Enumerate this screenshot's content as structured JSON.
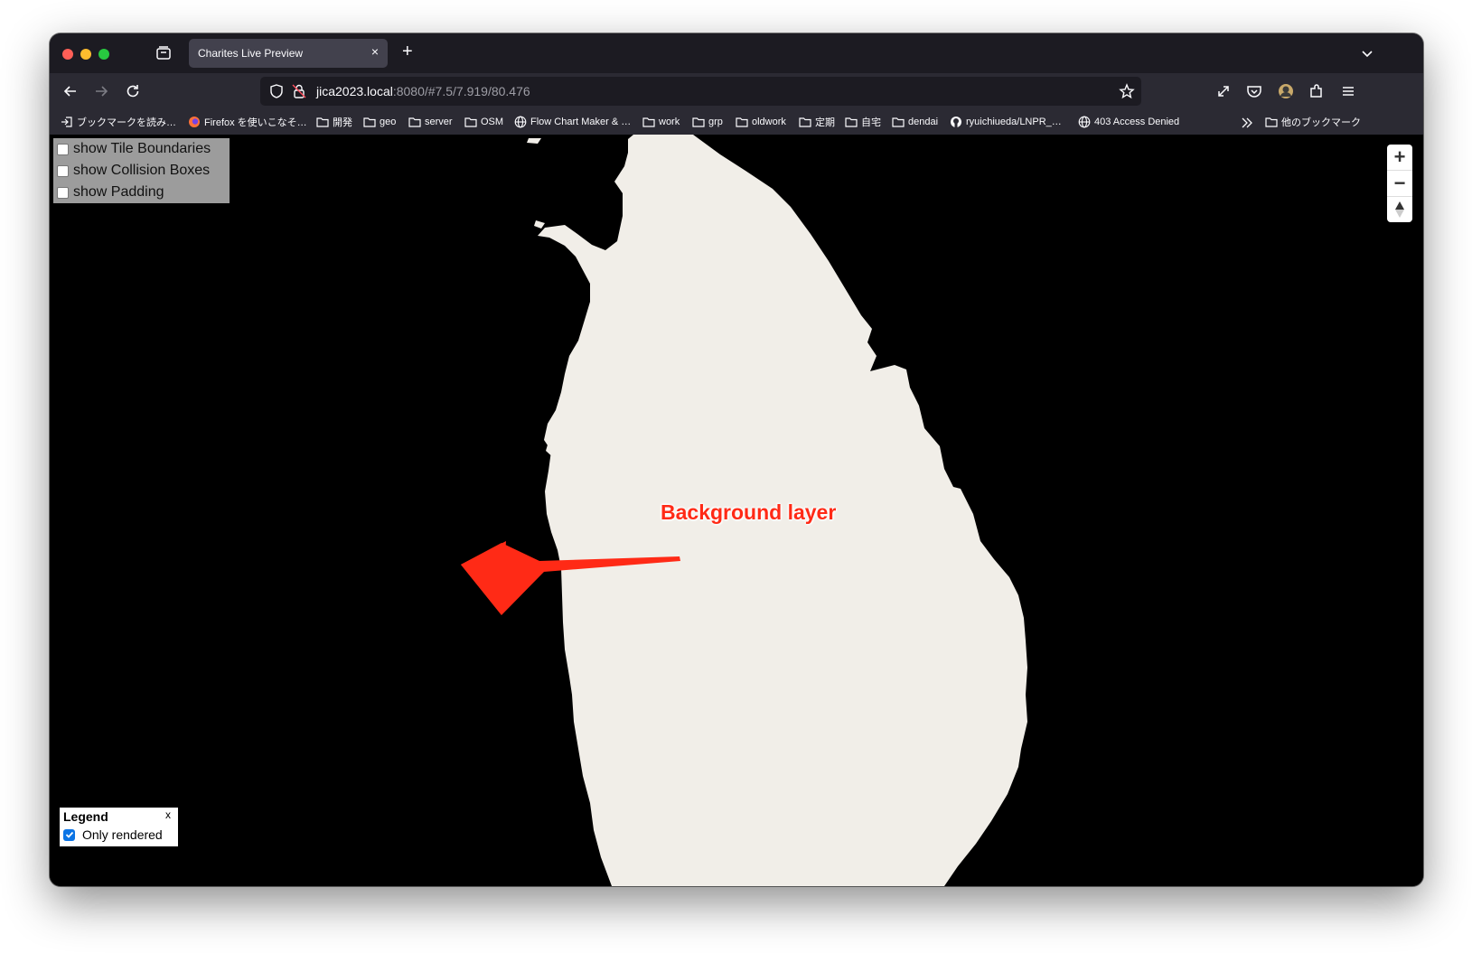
{
  "browser": {
    "tab_title": "Charites Live Preview",
    "tab_close": "×",
    "new_tab": "+",
    "url_host": "jica2023.local",
    "url_rest": ":8080/#7.5/7.919/80.476"
  },
  "bookmarks": [
    {
      "label": "ブックマークを読み…",
      "icon": "import-icon"
    },
    {
      "label": "Firefox を使いこなそ…",
      "icon": "firefox-icon"
    },
    {
      "label": "開発",
      "icon": "folder-icon"
    },
    {
      "label": "geo",
      "icon": "folder-icon"
    },
    {
      "label": "server",
      "icon": "folder-icon"
    },
    {
      "label": "OSM",
      "icon": "folder-icon"
    },
    {
      "label": "Flow Chart Maker & …",
      "icon": "globe-icon"
    },
    {
      "label": "work",
      "icon": "folder-icon"
    },
    {
      "label": "grp",
      "icon": "folder-icon"
    },
    {
      "label": "oldwork",
      "icon": "folder-icon"
    },
    {
      "label": "定期",
      "icon": "folder-icon"
    },
    {
      "label": "自宅",
      "icon": "folder-icon"
    },
    {
      "label": "dendai",
      "icon": "folder-icon"
    },
    {
      "label": "ryuichiueda/LNPR_…",
      "icon": "github-icon"
    },
    {
      "label": "403 Access Denied",
      "icon": "globe-icon"
    },
    {
      "label": "他のブックマーク",
      "icon": "folder-icon"
    }
  ],
  "debug_panel": {
    "tile_boundaries": "show Tile Boundaries",
    "collision_boxes": "show Collision Boxes",
    "padding": "show Padding"
  },
  "zoom": {
    "zoom_in": "+",
    "zoom_out": "−"
  },
  "annotation": {
    "label": "Background layer"
  },
  "legend": {
    "title": "Legend",
    "close": "x",
    "only_rendered": "Only rendered",
    "only_rendered_checked": true
  },
  "colors": {
    "land": "#f1eee8",
    "water": "#000000",
    "annotation": "#ff2a16",
    "browser_chrome": "#2b2a33"
  }
}
